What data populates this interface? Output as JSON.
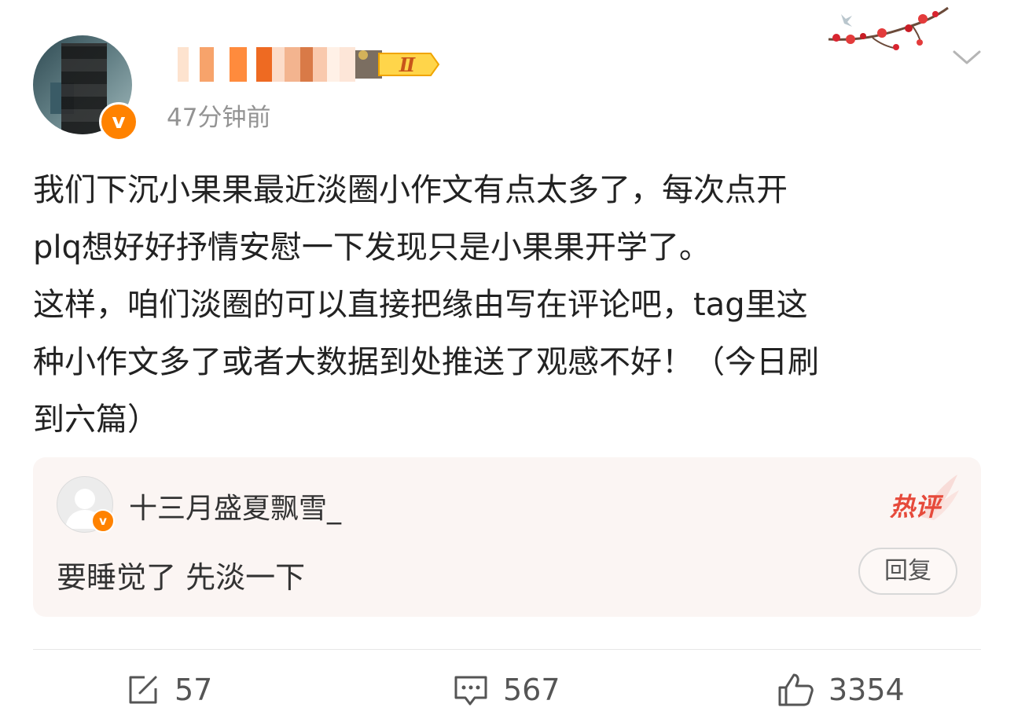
{
  "post": {
    "time": "47分钟前",
    "text_lines": [
      "我们下沉小果果最近淡圈小作文有点太多了，每次点开",
      "plq想好好抒情安慰一下发现只是小果果开学了。",
      "这样，咱们淡圈的可以直接把缘由写在评论吧，tag里这",
      "种小作文多了或者大数据到处推送了观感不好！（今日刷",
      "到六篇）"
    ],
    "level_badge": "Ⅱ",
    "verified_icon": "v-badge-icon"
  },
  "hot_comment": {
    "username": "十三月盛夏飘雪_",
    "label": "热评",
    "text": "要睡觉了 先淡一下",
    "reply_label": "回复"
  },
  "actions": {
    "repost_count": "57",
    "comment_count": "567",
    "like_count": "3354"
  },
  "colors": {
    "accent": "#ff8200",
    "hot": "#e64a3b",
    "muted": "#939393"
  }
}
